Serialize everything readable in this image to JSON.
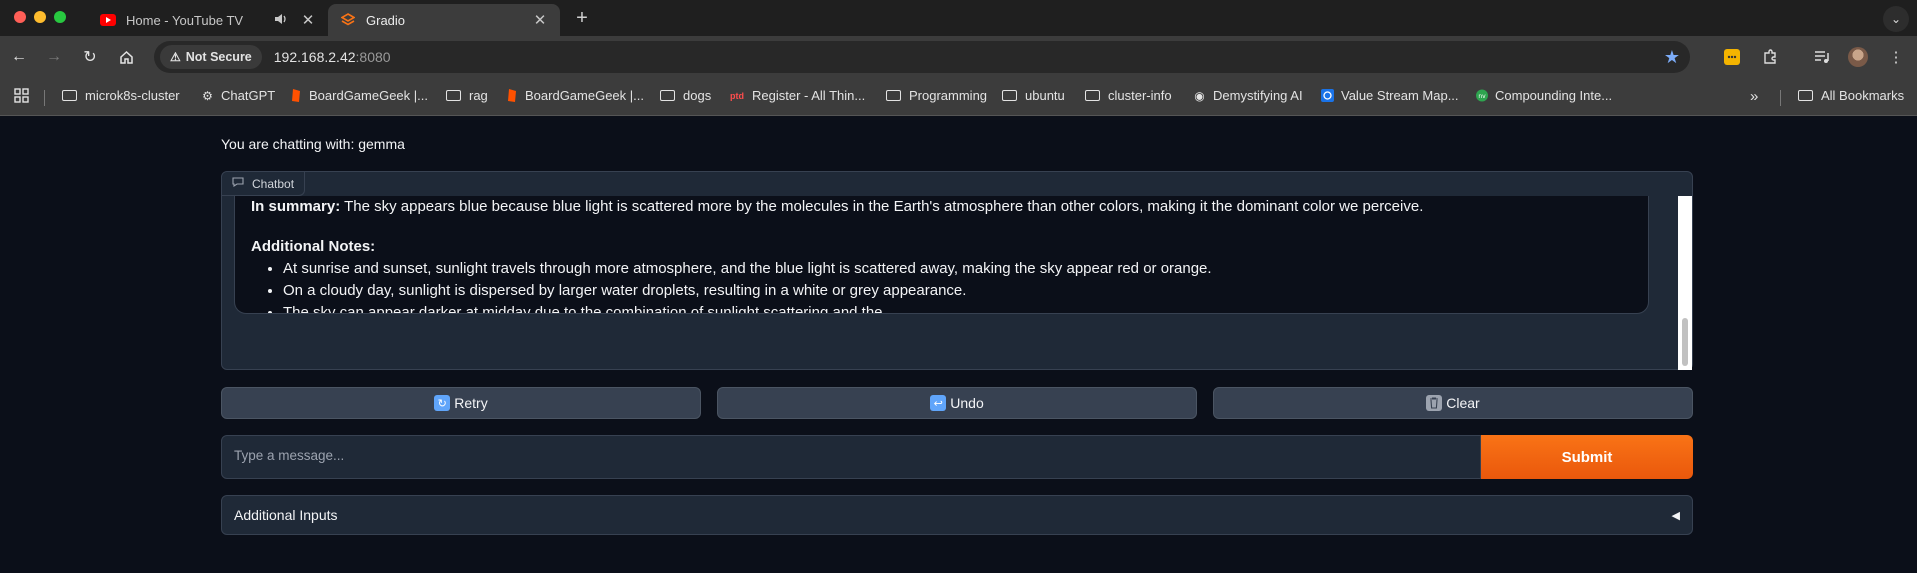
{
  "browser": {
    "tabs": [
      {
        "title": "Home - YouTube TV",
        "favicon": "youtube-icon",
        "audio": "speaker-icon"
      },
      {
        "title": "Gradio",
        "favicon": "gradio-icon",
        "active": true
      }
    ],
    "new_tab_label": "+",
    "security_label": "Not Secure",
    "url_host": "192.168.2.42",
    "url_port": ":8080",
    "bookmarks": [
      "microk8s-cluster",
      "ChatGPT",
      "BoardGameGeek |...",
      "rag",
      "BoardGameGeek |...",
      "dogs",
      "Register - All Thin...",
      "Programming",
      "ubuntu",
      "cluster-info",
      "Demystifying AI",
      "Value Stream Map...",
      "Compounding Inte..."
    ],
    "more_label": "»",
    "all_bookmarks": "All Bookmarks"
  },
  "app": {
    "chatting_with": "You are chatting with: gemma",
    "chatbot_label": "Chatbot",
    "message": {
      "summary_bold": "In summary:",
      "summary_text": " The sky appears blue because blue light is scattered more by the molecules in the Earth's atmosphere than other colors, making it the dominant color we perceive.",
      "notes_heading": "Additional Notes:",
      "notes": [
        "At sunrise and sunset, sunlight travels through more atmosphere, and the blue light is scattered away, making the sky appear red or orange.",
        "On a cloudy day, sunlight is dispersed by larger water droplets, resulting in a white or grey appearance.",
        "The sky can appear darker at midday due to the combination of sunlight scattering and the"
      ]
    },
    "buttons": {
      "retry": "Retry",
      "undo": "Undo",
      "clear": "Clear",
      "submit": "Submit"
    },
    "input_placeholder": "Type a message...",
    "additional_inputs": "Additional Inputs",
    "accordion_arrow": "◀"
  },
  "colors": {
    "accent": "#ea580c",
    "background": "#0b0f19",
    "panel": "#1f2937"
  }
}
